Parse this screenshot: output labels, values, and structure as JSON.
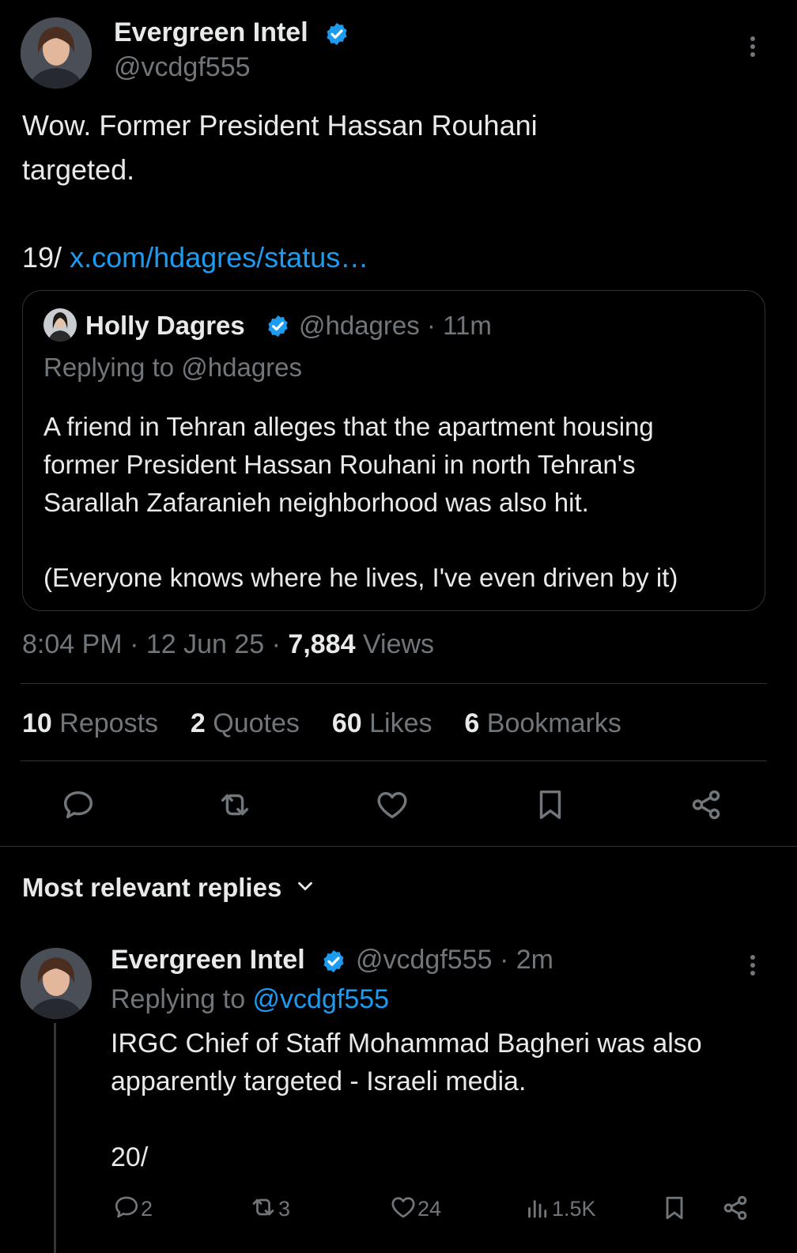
{
  "main_tweet": {
    "author_name": "Evergreen Intel",
    "author_handle": "@vcdgf555",
    "text_line1": "Wow.  Former President Hassan Rouhani",
    "text_line2": "targeted.",
    "thread_number": "19/",
    "link_text": "x.com/hdagres/status…",
    "timestamp": "8:04 PM · 12 Jun 25 · ",
    "views_count": "7,884",
    "views_label": " Views",
    "stats": {
      "reposts_count": "10",
      "reposts_label": "Reposts",
      "quotes_count": "2",
      "quotes_label": "Quotes",
      "likes_count": "60",
      "likes_label": "Likes",
      "bookmarks_count": "6",
      "bookmarks_label": "Bookmarks"
    }
  },
  "quoted_tweet": {
    "author_name": "Holly Dagres",
    "author_handle": "@hdagres · 11m",
    "replying_to": "Replying to @hdagres",
    "text_lines": [
      "A friend in Tehran alleges that the apartment housing",
      "former President Hassan Rouhani in north Tehran's",
      "Sarallah Zafaranieh neighborhood was also hit.",
      "(Everyone knows where he lives, I've even driven by it)"
    ]
  },
  "replies_header": {
    "label": "Most relevant replies"
  },
  "reply": {
    "author_name": "Evergreen Intel",
    "author_handle": "@vcdgf555 · 2m",
    "replying_prefix": "Replying to ",
    "replying_handle": "@vcdgf555",
    "text_line1": "IRGC Chief of Staff Mohammad Bagheri was also",
    "text_line2": "apparently targeted - Israeli media.",
    "thread_number": "20/",
    "counts": {
      "replies": "2",
      "reposts": "3",
      "likes": "24",
      "views": "1.5K"
    }
  },
  "colors": {
    "background": "#000000",
    "text_primary": "#e7e9ea",
    "text_secondary": "#71767b",
    "accent": "#1d9bf0",
    "divider": "#2f3336"
  }
}
